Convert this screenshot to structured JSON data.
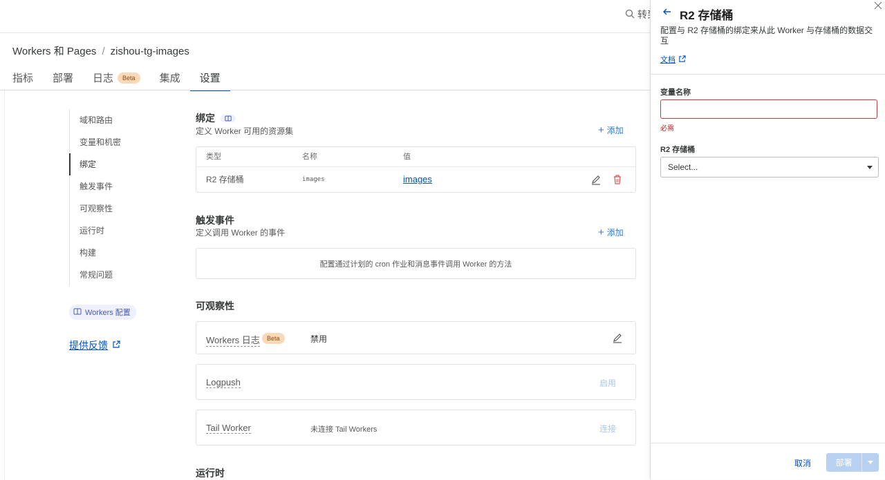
{
  "topbar": {
    "search_partial": "转到"
  },
  "breadcrumb": {
    "root": "Workers 和 Pages",
    "separator": "/",
    "current": "zishou-tg-images"
  },
  "tabs": [
    {
      "label": "指标"
    },
    {
      "label": "部署"
    },
    {
      "label": "日志",
      "badge": "Beta"
    },
    {
      "label": "集成"
    },
    {
      "label": "设置"
    }
  ],
  "sidenav": {
    "items": [
      "域和路由",
      "变量和机密",
      "绑定",
      "触发事件",
      "可观察性",
      "运行时",
      "构建",
      "常规问题"
    ],
    "active_index": 2,
    "config_chip": "Workers 配置",
    "feedback": "提供反馈"
  },
  "bindings": {
    "title": "绑定",
    "desc": "定义 Worker 可用的资源集",
    "add": "添加",
    "columns": [
      "类型",
      "名称",
      "值"
    ],
    "row": {
      "type": "R2 存储桶",
      "name": "images",
      "value": "images"
    }
  },
  "triggers": {
    "title": "触发事件",
    "desc": "定义调用 Worker 的事件",
    "add": "添加",
    "empty": "配置通过计划的 cron 作业和消息事件调用 Worker 的方法"
  },
  "observability": {
    "title": "可观察性",
    "logs": {
      "label": "Workers 日志",
      "badge": "Beta",
      "status": "禁用"
    },
    "logpush": {
      "label": "Logpush",
      "action": "启用"
    },
    "tail": {
      "label": "Tail Worker",
      "status": "未连接 Tail Workers",
      "action": "连接"
    }
  },
  "runtime": {
    "title": "运行时"
  },
  "panel": {
    "title": "R2 存储桶",
    "desc": "配置与 R2 存储桶的绑定来从此 Worker 与存储桶的数据交互",
    "docs": "文档",
    "var_label": "变量名称",
    "var_value": "",
    "required": "必需",
    "bucket_label": "R2 存储桶",
    "bucket_placeholder": "Select...",
    "cancel": "取消",
    "deploy": "部署"
  },
  "colors": {
    "accent": "#0051c3",
    "error": "#c53b3b",
    "beta_bg": "#fbd9b8"
  }
}
